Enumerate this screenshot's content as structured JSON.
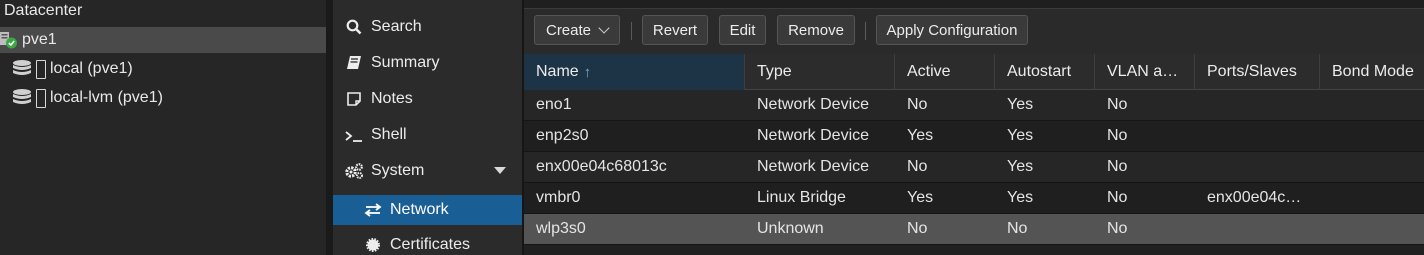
{
  "tree": {
    "root": "Datacenter",
    "items": [
      {
        "label": "pve1",
        "icon": "node-online-icon"
      },
      {
        "label": "local (pve1)",
        "icon": "storage-icon"
      },
      {
        "label": "local-lvm (pve1)",
        "icon": "storage-icon"
      }
    ]
  },
  "nav": {
    "items": [
      {
        "label": "Search",
        "icon": "search-icon"
      },
      {
        "label": "Summary",
        "icon": "book-icon"
      },
      {
        "label": "Notes",
        "icon": "note-icon"
      },
      {
        "label": "Shell",
        "icon": "terminal-icon"
      },
      {
        "label": "System",
        "icon": "gears-icon"
      },
      {
        "label": "Network",
        "icon": "exchange-icon"
      },
      {
        "label": "Certificates",
        "icon": "certificate-icon"
      }
    ]
  },
  "toolbar": {
    "create": "Create",
    "revert": "Revert",
    "edit": "Edit",
    "remove": "Remove",
    "apply": "Apply Configuration"
  },
  "grid": {
    "columns": [
      "Name",
      "Type",
      "Active",
      "Autostart",
      "VLAN a…",
      "Ports/Slaves",
      "Bond Mode"
    ],
    "sort_arrow": "↑",
    "rows": [
      [
        "eno1",
        "Network Device",
        "No",
        "Yes",
        "No",
        "",
        ""
      ],
      [
        "enp2s0",
        "Network Device",
        "Yes",
        "Yes",
        "No",
        "",
        ""
      ],
      [
        "enx00e04c68013c",
        "Network Device",
        "No",
        "Yes",
        "No",
        "",
        ""
      ],
      [
        "vmbr0",
        "Linux Bridge",
        "Yes",
        "Yes",
        "No",
        "enx00e04c…",
        ""
      ],
      [
        "wlp3s0",
        "Unknown",
        "No",
        "No",
        "No",
        "",
        ""
      ]
    ]
  },
  "colors": {
    "accent": "#1a5e96",
    "online": "#3aa845"
  }
}
